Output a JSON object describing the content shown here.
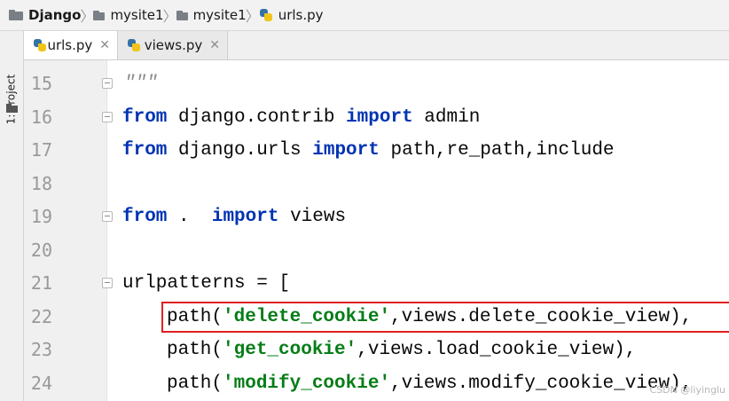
{
  "breadcrumb": {
    "items": [
      {
        "label": "Django"
      },
      {
        "label": "mysite1"
      },
      {
        "label": "mysite1"
      },
      {
        "label": "urls.py"
      }
    ]
  },
  "toolstrip": {
    "project_label": "1: Project"
  },
  "tabs": [
    {
      "label": "urls.py",
      "active": true
    },
    {
      "label": "views.py",
      "active": false
    }
  ],
  "editor": {
    "lines": [
      {
        "num": "15",
        "text": "\"\"\""
      },
      {
        "num": "16",
        "kw1": "from",
        "t1": " django.contrib ",
        "kw2": "import",
        "t2": " admin"
      },
      {
        "num": "17",
        "kw1": "from",
        "t1": " django.urls ",
        "kw2": "import",
        "t2": " path,re_path,include"
      },
      {
        "num": "18"
      },
      {
        "num": "19",
        "kw1": "from",
        "t1": " .  ",
        "kw2": "import",
        "t2": " views"
      },
      {
        "num": "20"
      },
      {
        "num": "21",
        "text": "urlpatterns = ["
      },
      {
        "num": "22",
        "p1": "path(",
        "s1": "'delete_cookie'",
        "p2": ",views.delete_cookie_view),"
      },
      {
        "num": "23",
        "p1": "path(",
        "s1": "'get_cookie'",
        "p2": ",views.load_cookie_view),"
      },
      {
        "num": "24",
        "p1": "path(",
        "s1": "'modify_cookie'",
        "p2": ",views.modify_cookie_view),"
      }
    ]
  },
  "watermark": "CSDN @liyinglu"
}
